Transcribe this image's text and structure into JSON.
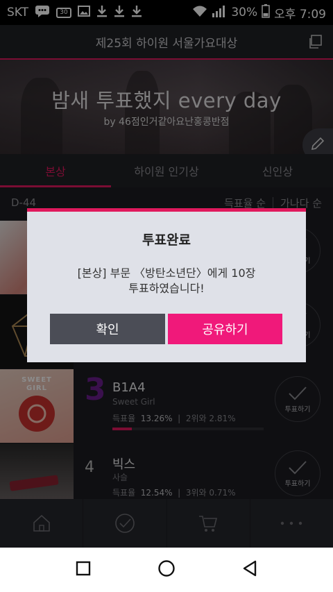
{
  "status_bar": {
    "carrier": "SKT",
    "calendar_num": "30",
    "battery": "30%",
    "time": "오후 7:09"
  },
  "header": {
    "title": "제25회 하이원 서울가요대상"
  },
  "banner": {
    "title": "밤새 투표했지 every day",
    "subtitle": "by 46점인거같아요난홍콩반점"
  },
  "tabs": [
    {
      "label": "본상",
      "active": true
    },
    {
      "label": "하이원 인기상",
      "active": false
    },
    {
      "label": "신인상",
      "active": false
    }
  ],
  "sort": {
    "countdown": "D-44",
    "option_rate": "득표율 순",
    "option_alpha": "가나다 순"
  },
  "vote_button_label": "투표하기",
  "list": [
    {
      "rank": "",
      "artist": "",
      "song": "",
      "rate_label": "",
      "rate": "",
      "gap": "",
      "progress": 0
    },
    {
      "rank": "",
      "artist": "",
      "song": "",
      "rate_label": "",
      "rate": "",
      "gap": "",
      "progress": 0
    },
    {
      "rank": "3",
      "artist": "B1A4",
      "song": "Sweet Girl",
      "rate_label": "득표율",
      "rate": "13.26%",
      "gap": "2위와 2.81%",
      "progress": 0.13
    },
    {
      "rank": "4",
      "artist": "빅스",
      "song": "사슬",
      "rate_label": "득표율",
      "rate": "12.54%",
      "gap": "3위와 0.71%",
      "progress": 0.12
    }
  ],
  "thumb_text": {
    "sweet_girl_1": "SWEET",
    "sweet_girl_2": "GIRL"
  },
  "dialog": {
    "title": "투표완료",
    "message_line1": "[본상] 부문 〈방탄소년단〉에게 10장",
    "message_line2": "투표하였습니다!",
    "confirm_label": "확인",
    "share_label": "공유하기"
  },
  "colors": {
    "accent": "#e0195d",
    "share": "#f0197a",
    "rank3": "#6a1e8c"
  }
}
